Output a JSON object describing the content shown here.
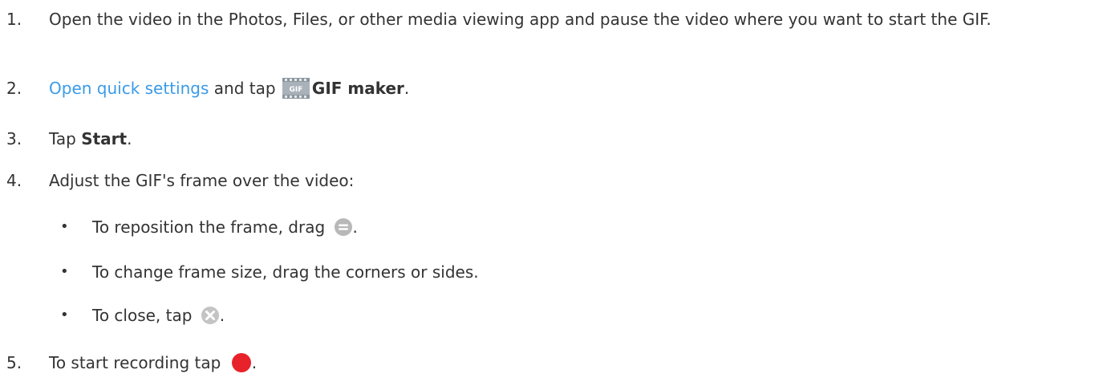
{
  "steps": [
    {
      "number": "1.",
      "text": "Open the video in the Photos, Files, or other media viewing app and pause the video where you want to start the GIF."
    },
    {
      "number": "2.",
      "link": "Open quick settings",
      "mid": " and tap ",
      "icon": "gif-maker-icon",
      "bold": "GIF maker",
      "end": "."
    },
    {
      "number": "3.",
      "pre": "Tap ",
      "bold": "Start",
      "end": "."
    },
    {
      "number": "4.",
      "text": "Adjust the GIF's frame over the video:",
      "bullets": [
        {
          "bullet": "•",
          "text": "To reposition the frame, drag ",
          "icon": "drag-handle-icon",
          "end": "."
        },
        {
          "bullet": "•",
          "text": "To change frame size, drag the corners or sides."
        },
        {
          "bullet": "•",
          "text": "To close, tap ",
          "icon": "close-circle-icon",
          "end": "."
        }
      ]
    },
    {
      "number": "5.",
      "text": "To start recording tap ",
      "icon": "record-dot-icon",
      "end": "."
    }
  ],
  "colors": {
    "text": "#333333",
    "link": "#3a9be8",
    "record": "#e8222a",
    "icon_gray": "#b8b8b8"
  }
}
